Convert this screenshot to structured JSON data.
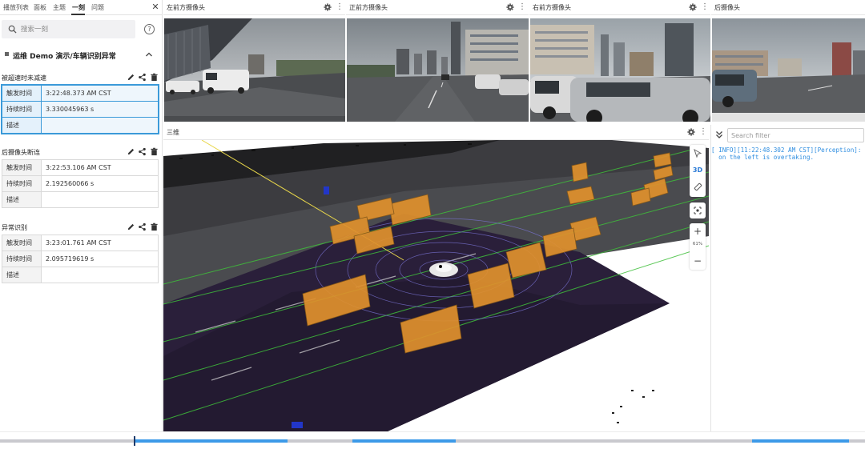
{
  "sidebar": {
    "tabs": [
      {
        "label": "播放列表",
        "active": false
      },
      {
        "label": "面板",
        "active": false
      },
      {
        "label": "主题",
        "active": false
      },
      {
        "label": "一刻",
        "active": true
      },
      {
        "label": "问题",
        "active": false
      }
    ],
    "search_placeholder": "搜索一刻",
    "group_title": "运维 Demo 演示/车辆识别异常",
    "events": [
      {
        "title": "被超速时未减速",
        "selected": true,
        "rows": [
          {
            "key": "触发时间",
            "value": "3:22:48.373 AM CST"
          },
          {
            "key": "持续时间",
            "value": "3.330045963 s"
          },
          {
            "key": "描述",
            "value": ""
          }
        ]
      },
      {
        "title": "后摄像头断连",
        "selected": false,
        "rows": [
          {
            "key": "触发时间",
            "value": "3:22:53.106 AM CST"
          },
          {
            "key": "持续时间",
            "value": "2.192560066 s"
          },
          {
            "key": "描述",
            "value": ""
          }
        ]
      },
      {
        "title": "异常识别",
        "selected": false,
        "rows": [
          {
            "key": "触发时间",
            "value": "3:23:01.761 AM CST"
          },
          {
            "key": "持续时间",
            "value": "2.095719619 s"
          },
          {
            "key": "描述",
            "value": ""
          }
        ]
      }
    ]
  },
  "cameras": [
    {
      "title": "左前方摄像头"
    },
    {
      "title": "正前方摄像头"
    },
    {
      "title": "右前方摄像头"
    },
    {
      "title": "后摄像头"
    }
  ],
  "scene3d": {
    "title": "三维",
    "mode_label": "3D",
    "zoom_level": "61%"
  },
  "log": {
    "filter_placeholder": "Search filter",
    "lines": [
      "[ INFO][11:22:48.302 AM CST][Perception]:",
      "  on the left is overtaking."
    ]
  },
  "timeline": {
    "playhead_fraction": 0.155,
    "segments": [
      {
        "start": 0.155,
        "end": 0.333
      },
      {
        "start": 0.407,
        "end": 0.526
      },
      {
        "start": 0.869,
        "end": 0.981
      }
    ]
  },
  "colors": {
    "selected_border": "#3b9ad9",
    "log_text": "#2f8ee0",
    "timeline_segment": "#3c9ae8",
    "bbox_fill": "#e0912d",
    "road_plane": "#2a1f3a"
  }
}
